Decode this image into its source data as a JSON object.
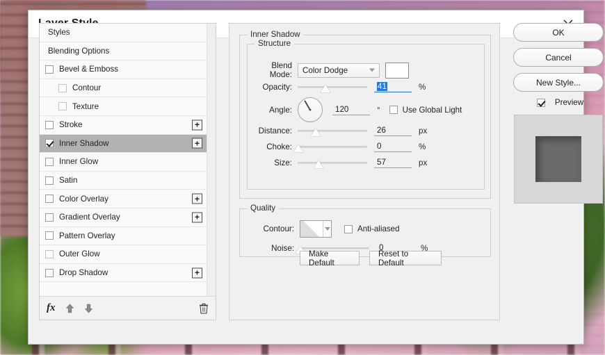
{
  "window": {
    "title": "Layer Style",
    "close_icon": "close-icon"
  },
  "styles_panel": {
    "items": [
      {
        "label": "Styles",
        "checkbox": "none",
        "indent": false,
        "plus": false,
        "selected": false
      },
      {
        "label": "Blending Options",
        "checkbox": "none",
        "indent": false,
        "plus": false,
        "selected": false
      },
      {
        "label": "Bevel & Emboss",
        "checkbox": "unchecked",
        "indent": false,
        "plus": false,
        "selected": false
      },
      {
        "label": "Contour",
        "checkbox": "dim",
        "indent": true,
        "plus": false,
        "selected": false
      },
      {
        "label": "Texture",
        "checkbox": "dim",
        "indent": true,
        "plus": false,
        "selected": false
      },
      {
        "label": "Stroke",
        "checkbox": "unchecked",
        "indent": false,
        "plus": true,
        "selected": false
      },
      {
        "label": "Inner Shadow",
        "checkbox": "checked",
        "indent": false,
        "plus": true,
        "selected": true
      },
      {
        "label": "Inner Glow",
        "checkbox": "unchecked",
        "indent": false,
        "plus": false,
        "selected": false
      },
      {
        "label": "Satin",
        "checkbox": "unchecked",
        "indent": false,
        "plus": false,
        "selected": false
      },
      {
        "label": "Color Overlay",
        "checkbox": "unchecked",
        "indent": false,
        "plus": true,
        "selected": false
      },
      {
        "label": "Gradient Overlay",
        "checkbox": "unchecked",
        "indent": false,
        "plus": true,
        "selected": false
      },
      {
        "label": "Pattern Overlay",
        "checkbox": "unchecked",
        "indent": false,
        "plus": false,
        "selected": false
      },
      {
        "label": "Outer Glow",
        "checkbox": "dim",
        "indent": false,
        "plus": false,
        "selected": false
      },
      {
        "label": "Drop Shadow",
        "checkbox": "unchecked",
        "indent": false,
        "plus": true,
        "selected": false
      }
    ],
    "plus_label": "+",
    "footer": {
      "fx_label": "fx",
      "fx_icon": "fx-icon",
      "move_up_icon": "arrow-up-icon",
      "move_down_icon": "arrow-down-icon",
      "delete_icon": "trash-icon"
    }
  },
  "settings": {
    "section_title": "Inner Shadow",
    "structure": {
      "legend": "Structure",
      "blend_mode": {
        "label": "Blend Mode:",
        "value": "Color Dodge",
        "color_swatch": "#ffffff"
      },
      "opacity": {
        "label": "Opacity:",
        "value": "41",
        "unit": "%",
        "slider_pct": 41,
        "selected": true
      },
      "angle": {
        "label": "Angle:",
        "value": "120",
        "unit": "°",
        "dial_degrees": 120
      },
      "use_global_light": {
        "label": "Use Global Light",
        "checked": false
      },
      "distance": {
        "label": "Distance:",
        "value": "26",
        "unit": "px",
        "slider_pct": 26
      },
      "choke": {
        "label": "Choke:",
        "value": "0",
        "unit": "%",
        "slider_pct": 0
      },
      "size": {
        "label": "Size:",
        "value": "57",
        "unit": "px",
        "slider_pct": 38
      }
    },
    "quality": {
      "legend": "Quality",
      "contour": {
        "label": "Contour:",
        "thumbnail": "linear-ramp"
      },
      "anti_aliased": {
        "label": "Anti-aliased",
        "checked": false
      },
      "noise": {
        "label": "Noise:",
        "value": "0",
        "unit": "%",
        "slider_pct": 0
      }
    },
    "buttons": {
      "make_default": "Make Default",
      "reset_to_default": "Reset to Default"
    }
  },
  "actions": {
    "ok": "OK",
    "cancel": "Cancel",
    "new_style": "New Style...",
    "preview": {
      "label": "Preview",
      "checked": true
    }
  }
}
